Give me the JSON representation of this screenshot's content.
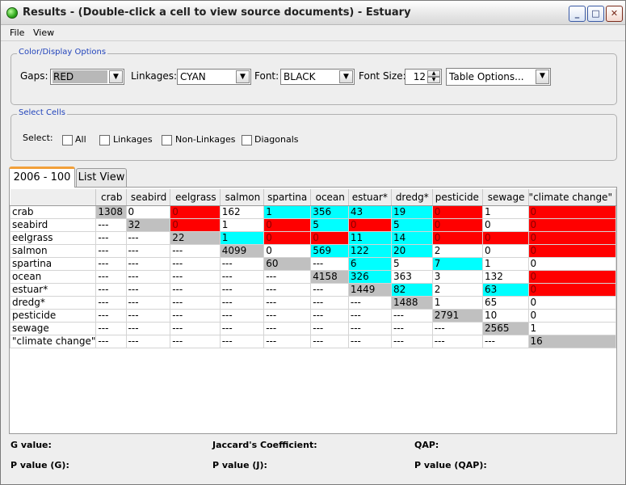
{
  "window": {
    "title": "Results - (Double-click a cell to view source documents) - Estuary",
    "minimize": "_",
    "maximize": "□",
    "close": "✕"
  },
  "menu": {
    "file": "File",
    "view": "View"
  },
  "options": {
    "legend": "Color/Display Options",
    "gaps_label": "Gaps:",
    "gaps_value": "RED",
    "linkages_label": "Linkages:",
    "linkages_value": "CYAN",
    "font_label": "Font:",
    "font_value": "BLACK",
    "fontsize_label": "Font Size:",
    "fontsize_value": "12",
    "table_options_value": "Table Options..."
  },
  "select": {
    "legend": "Select Cells",
    "label": "Select:",
    "all": "All",
    "linkages": "Linkages",
    "non_linkages": "Non-Linkages",
    "diagonals": "Diagonals"
  },
  "tabs": {
    "active": "2006 - 100",
    "list_view": "List View"
  },
  "colors": {
    "gap": "#ff0000",
    "linkage": "#00ffff",
    "diagonal": "#c0c0c0"
  },
  "table": {
    "columns": [
      "",
      "crab",
      "seabird",
      "eelgrass",
      "salmon",
      "spartina",
      "ocean",
      "estuar*",
      "dredg*",
      "pesticide",
      "sewage",
      "\"climate change\""
    ],
    "rows": [
      {
        "label": "crab",
        "cells": [
          [
            "1308",
            "g"
          ],
          [
            "0",
            "w"
          ],
          [
            "0",
            "r"
          ],
          [
            "162",
            "w"
          ],
          [
            "1",
            "c"
          ],
          [
            "356",
            "c"
          ],
          [
            "43",
            "c"
          ],
          [
            "19",
            "c"
          ],
          [
            "0",
            "r"
          ],
          [
            "1",
            "w"
          ],
          [
            "0",
            "r"
          ]
        ]
      },
      {
        "label": "seabird",
        "cells": [
          [
            "---",
            "w"
          ],
          [
            "32",
            "g"
          ],
          [
            "0",
            "r"
          ],
          [
            "1",
            "w"
          ],
          [
            "0",
            "r"
          ],
          [
            "5",
            "c"
          ],
          [
            "0",
            "r"
          ],
          [
            "5",
            "c"
          ],
          [
            "0",
            "r"
          ],
          [
            "0",
            "w"
          ],
          [
            "0",
            "r"
          ]
        ]
      },
      {
        "label": "eelgrass",
        "cells": [
          [
            "---",
            "w"
          ],
          [
            "---",
            "w"
          ],
          [
            "22",
            "g"
          ],
          [
            "1",
            "c"
          ],
          [
            "0",
            "r"
          ],
          [
            "0",
            "r"
          ],
          [
            "11",
            "c"
          ],
          [
            "14",
            "c"
          ],
          [
            "0",
            "r"
          ],
          [
            "0",
            "r"
          ],
          [
            "0",
            "r"
          ]
        ]
      },
      {
        "label": "salmon",
        "cells": [
          [
            "---",
            "w"
          ],
          [
            "---",
            "w"
          ],
          [
            "---",
            "w"
          ],
          [
            "4099",
            "g"
          ],
          [
            "0",
            "w"
          ],
          [
            "569",
            "c"
          ],
          [
            "122",
            "c"
          ],
          [
            "20",
            "c"
          ],
          [
            "2",
            "w"
          ],
          [
            "0",
            "w"
          ],
          [
            "0",
            "r"
          ]
        ]
      },
      {
        "label": "spartina",
        "cells": [
          [
            "---",
            "w"
          ],
          [
            "---",
            "w"
          ],
          [
            "---",
            "w"
          ],
          [
            "---",
            "w"
          ],
          [
            "60",
            "g"
          ],
          [
            "---",
            "w"
          ],
          [
            "6",
            "c"
          ],
          [
            "5",
            "w"
          ],
          [
            "7",
            "c"
          ],
          [
            "1",
            "w"
          ],
          [
            "0",
            "w"
          ]
        ]
      },
      {
        "label": "ocean",
        "cells": [
          [
            "---",
            "w"
          ],
          [
            "---",
            "w"
          ],
          [
            "---",
            "w"
          ],
          [
            "---",
            "w"
          ],
          [
            "---",
            "w"
          ],
          [
            "4158",
            "g"
          ],
          [
            "326",
            "c"
          ],
          [
            "363",
            "w"
          ],
          [
            "3",
            "w"
          ],
          [
            "132",
            "w"
          ],
          [
            "0",
            "r"
          ]
        ]
      },
      {
        "label": "estuar*",
        "cells": [
          [
            "---",
            "w"
          ],
          [
            "---",
            "w"
          ],
          [
            "---",
            "w"
          ],
          [
            "---",
            "w"
          ],
          [
            "---",
            "w"
          ],
          [
            "---",
            "w"
          ],
          [
            "1449",
            "g"
          ],
          [
            "82",
            "c"
          ],
          [
            "2",
            "w"
          ],
          [
            "63",
            "c"
          ],
          [
            "0",
            "r"
          ]
        ]
      },
      {
        "label": "dredg*",
        "cells": [
          [
            "---",
            "w"
          ],
          [
            "---",
            "w"
          ],
          [
            "---",
            "w"
          ],
          [
            "---",
            "w"
          ],
          [
            "---",
            "w"
          ],
          [
            "---",
            "w"
          ],
          [
            "---",
            "w"
          ],
          [
            "1488",
            "g"
          ],
          [
            "1",
            "w"
          ],
          [
            "65",
            "w"
          ],
          [
            "0",
            "w"
          ]
        ]
      },
      {
        "label": "pesticide",
        "cells": [
          [
            "---",
            "w"
          ],
          [
            "---",
            "w"
          ],
          [
            "---",
            "w"
          ],
          [
            "---",
            "w"
          ],
          [
            "---",
            "w"
          ],
          [
            "---",
            "w"
          ],
          [
            "---",
            "w"
          ],
          [
            "---",
            "w"
          ],
          [
            "2791",
            "g"
          ],
          [
            "10",
            "w"
          ],
          [
            "0",
            "w"
          ]
        ]
      },
      {
        "label": "sewage",
        "cells": [
          [
            "---",
            "w"
          ],
          [
            "---",
            "w"
          ],
          [
            "---",
            "w"
          ],
          [
            "---",
            "w"
          ],
          [
            "---",
            "w"
          ],
          [
            "---",
            "w"
          ],
          [
            "---",
            "w"
          ],
          [
            "---",
            "w"
          ],
          [
            "---",
            "w"
          ],
          [
            "2565",
            "g"
          ],
          [
            "1",
            "w"
          ]
        ]
      },
      {
        "label": "\"climate change\"",
        "cells": [
          [
            "---",
            "w"
          ],
          [
            "---",
            "w"
          ],
          [
            "---",
            "w"
          ],
          [
            "---",
            "w"
          ],
          [
            "---",
            "w"
          ],
          [
            "---",
            "w"
          ],
          [
            "---",
            "w"
          ],
          [
            "---",
            "w"
          ],
          [
            "---",
            "w"
          ],
          [
            "---",
            "w"
          ],
          [
            "16",
            "g"
          ]
        ]
      }
    ]
  },
  "stats": {
    "g_value": "G value:",
    "jaccard": "Jaccard's Coefficient:",
    "qap": "QAP:",
    "p_value_g": "P value (G):",
    "p_value_j": "P value (J):",
    "p_value_qap": "P value (QAP):"
  }
}
